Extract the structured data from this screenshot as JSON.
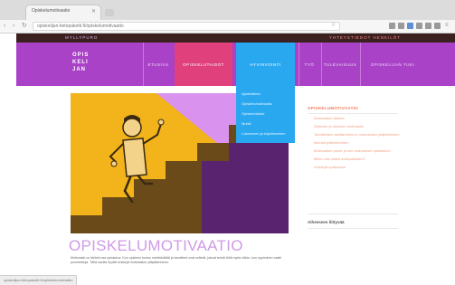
{
  "browser": {
    "tab_title": "Opiskelumotivaatio",
    "url": "opiskelijan-tietopaketti.fi/opiskelumotivaatio"
  },
  "topbar": {
    "left_text": "MYLLYPURO",
    "right_text": "YHTEYSTIEDOT HENKILÖT"
  },
  "site": {
    "logo_lines": [
      "OPIS",
      "KELI",
      "JAN"
    ]
  },
  "nav": {
    "items": [
      {
        "label": "ETUSIVU"
      },
      {
        "label": "OPISKELUTAIDOT"
      },
      {
        "label": "HYVINVOINTI"
      },
      {
        "label": "TYÖ"
      },
      {
        "label": "TULEVAISUUS"
      },
      {
        "label": "OPISKELIJAN TUKI"
      }
    ]
  },
  "dropdown": {
    "items": [
      {
        "label": "Ajanhallinta"
      },
      {
        "label": "Opiskelumotivaatio"
      },
      {
        "label": "Opiskelutaidot"
      },
      {
        "label": "Muisti"
      },
      {
        "label": "Lukeminen ja kirjoittaminen"
      }
    ]
  },
  "aside": {
    "title": "OPISKELUMOTIVAATIO",
    "items": [
      {
        "label": "Motivaation lähteet"
      },
      {
        "label": "Sisäinen ja ulkoinen motivaatio"
      },
      {
        "label": "Tavoitteiden asettaminen ja motivaation ylläpitäminen"
      },
      {
        "label": "Itsensä palkitseminen"
      },
      {
        "label": "Motivaation puute ja sen vaikutukset opiskeluun"
      },
      {
        "label": "Miten voin lisätä motivaatiotani?"
      },
      {
        "label": "Vinkkejä opiskeluun"
      }
    ],
    "subtitle": "Aiheeseen liittyvää"
  },
  "page": {
    "title": "OPISKELUMOTIVAATIO",
    "body": "Motivaatio on tärkeä osa opiskelua. Kun opiskelu tuntuu mielekkäältä ja tavoitteet ovat selkeät, jaksat tehdä töitä myös silloin, kun oppiminen vaatii ponnisteluja. Tältä sivulta löydät vinkkejä motivaation ylläpitämiseen."
  },
  "statusbar": {
    "text": "opiskelijan-tietopaketti.fi/opiskelumotivaatio"
  },
  "colors": {
    "nav_purple": "#a942c7",
    "nav_hot_pink": "#e0407c",
    "nav_open_blue": "#29a8f0",
    "hero_yellow": "#f2b31b",
    "hero_brown": "#6b4a1a",
    "hero_purple": "#5a2370",
    "title_lavender": "#cf9ae6",
    "aside_orange": "#f07a5c"
  },
  "icons": [
    "back-arrow-icon",
    "forward-arrow-icon",
    "reload-icon",
    "tab-close-icon",
    "star-icon",
    "extension-icon",
    "menu-icon"
  ]
}
